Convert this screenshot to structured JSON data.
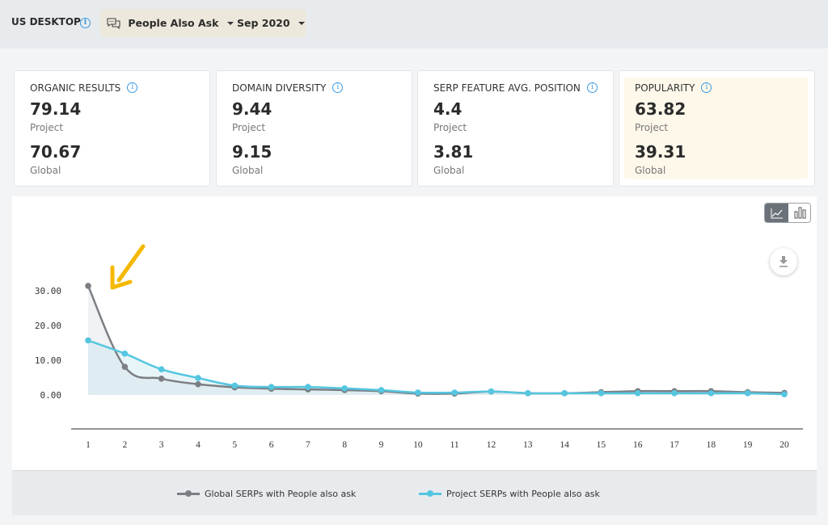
{
  "header": {
    "device_label": "US DESKTOP",
    "feature_filter": {
      "label": "People Also Ask",
      "icon": "chat-bubbles-icon"
    },
    "date_filter": {
      "label": "Sep 2020"
    }
  },
  "cards": [
    {
      "title": "ORGANIC RESULTS",
      "project_value": "79.14",
      "project_label": "Project",
      "global_value": "70.67",
      "global_label": "Global",
      "highlighted": false
    },
    {
      "title": "DOMAIN DIVERSITY",
      "project_value": "9.44",
      "project_label": "Project",
      "global_value": "9.15",
      "global_label": "Global",
      "highlighted": false
    },
    {
      "title": "SERP FEATURE AVG. POSITION",
      "project_value": "4.4",
      "project_label": "Project",
      "global_value": "3.81",
      "global_label": "Global",
      "highlighted": false
    },
    {
      "title": "POPULARITY",
      "project_value": "63.82",
      "project_label": "Project",
      "global_value": "39.31",
      "global_label": "Global",
      "highlighted": true
    }
  ],
  "chart_controls": {
    "view_modes": [
      "line",
      "bar"
    ],
    "active_view": "line",
    "download": "download-icon"
  },
  "colors": {
    "global": "#7b7f84",
    "project": "#55c6e0",
    "arrow": "#f5b800",
    "highlight_card": "#fef8ea"
  },
  "chart_data": {
    "type": "line",
    "title": "",
    "xlabel": "",
    "ylabel": "",
    "x": [
      1,
      2,
      3,
      4,
      5,
      6,
      7,
      8,
      9,
      10,
      11,
      12,
      13,
      14,
      15,
      16,
      17,
      18,
      19,
      20
    ],
    "ylim": [
      0,
      30
    ],
    "yticks": [
      "0.00",
      "10.00",
      "20.00",
      "30.00"
    ],
    "xticks": [
      "1",
      "2",
      "3",
      "4",
      "5",
      "6",
      "7",
      "8",
      "9",
      "10",
      "11",
      "12",
      "13",
      "14",
      "15",
      "16",
      "17",
      "18",
      "19",
      "20"
    ],
    "grid": false,
    "legend_position": "bottom",
    "series": [
      {
        "name": "Global SERPs with People also ask",
        "color": "#7b7f84",
        "values": [
          31.4,
          8.1,
          4.7,
          3.1,
          2.2,
          1.8,
          1.6,
          1.4,
          1.1,
          0.4,
          0.4,
          1.0,
          0.5,
          0.5,
          0.8,
          1.1,
          1.1,
          1.1,
          0.8,
          0.6
        ]
      },
      {
        "name": "Project SERPs with People also ask",
        "color": "#55c6e0",
        "values": [
          15.7,
          11.9,
          7.4,
          4.9,
          2.7,
          2.3,
          2.3,
          1.9,
          1.4,
          0.7,
          0.7,
          1.0,
          0.5,
          0.5,
          0.5,
          0.5,
          0.5,
          0.5,
          0.5,
          0.2
        ]
      }
    ],
    "annotations": [
      {
        "type": "arrow",
        "points_to_x": 1,
        "color": "#f5b800"
      }
    ]
  }
}
